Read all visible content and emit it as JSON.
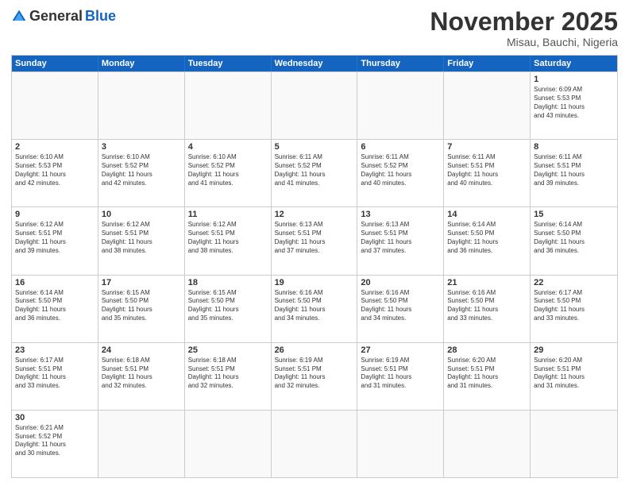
{
  "logo": {
    "general": "General",
    "blue": "Blue"
  },
  "title": "November 2025",
  "location": "Misau, Bauchi, Nigeria",
  "headers": [
    "Sunday",
    "Monday",
    "Tuesday",
    "Wednesday",
    "Thursday",
    "Friday",
    "Saturday"
  ],
  "rows": [
    [
      {
        "day": "",
        "text": ""
      },
      {
        "day": "",
        "text": ""
      },
      {
        "day": "",
        "text": ""
      },
      {
        "day": "",
        "text": ""
      },
      {
        "day": "",
        "text": ""
      },
      {
        "day": "",
        "text": ""
      },
      {
        "day": "1",
        "text": "Sunrise: 6:09 AM\nSunset: 5:53 PM\nDaylight: 11 hours\nand 43 minutes."
      }
    ],
    [
      {
        "day": "2",
        "text": "Sunrise: 6:10 AM\nSunset: 5:53 PM\nDaylight: 11 hours\nand 42 minutes."
      },
      {
        "day": "3",
        "text": "Sunrise: 6:10 AM\nSunset: 5:52 PM\nDaylight: 11 hours\nand 42 minutes."
      },
      {
        "day": "4",
        "text": "Sunrise: 6:10 AM\nSunset: 5:52 PM\nDaylight: 11 hours\nand 41 minutes."
      },
      {
        "day": "5",
        "text": "Sunrise: 6:11 AM\nSunset: 5:52 PM\nDaylight: 11 hours\nand 41 minutes."
      },
      {
        "day": "6",
        "text": "Sunrise: 6:11 AM\nSunset: 5:52 PM\nDaylight: 11 hours\nand 40 minutes."
      },
      {
        "day": "7",
        "text": "Sunrise: 6:11 AM\nSunset: 5:51 PM\nDaylight: 11 hours\nand 40 minutes."
      },
      {
        "day": "8",
        "text": "Sunrise: 6:11 AM\nSunset: 5:51 PM\nDaylight: 11 hours\nand 39 minutes."
      }
    ],
    [
      {
        "day": "9",
        "text": "Sunrise: 6:12 AM\nSunset: 5:51 PM\nDaylight: 11 hours\nand 39 minutes."
      },
      {
        "day": "10",
        "text": "Sunrise: 6:12 AM\nSunset: 5:51 PM\nDaylight: 11 hours\nand 38 minutes."
      },
      {
        "day": "11",
        "text": "Sunrise: 6:12 AM\nSunset: 5:51 PM\nDaylight: 11 hours\nand 38 minutes."
      },
      {
        "day": "12",
        "text": "Sunrise: 6:13 AM\nSunset: 5:51 PM\nDaylight: 11 hours\nand 37 minutes."
      },
      {
        "day": "13",
        "text": "Sunrise: 6:13 AM\nSunset: 5:51 PM\nDaylight: 11 hours\nand 37 minutes."
      },
      {
        "day": "14",
        "text": "Sunrise: 6:14 AM\nSunset: 5:50 PM\nDaylight: 11 hours\nand 36 minutes."
      },
      {
        "day": "15",
        "text": "Sunrise: 6:14 AM\nSunset: 5:50 PM\nDaylight: 11 hours\nand 36 minutes."
      }
    ],
    [
      {
        "day": "16",
        "text": "Sunrise: 6:14 AM\nSunset: 5:50 PM\nDaylight: 11 hours\nand 36 minutes."
      },
      {
        "day": "17",
        "text": "Sunrise: 6:15 AM\nSunset: 5:50 PM\nDaylight: 11 hours\nand 35 minutes."
      },
      {
        "day": "18",
        "text": "Sunrise: 6:15 AM\nSunset: 5:50 PM\nDaylight: 11 hours\nand 35 minutes."
      },
      {
        "day": "19",
        "text": "Sunrise: 6:16 AM\nSunset: 5:50 PM\nDaylight: 11 hours\nand 34 minutes."
      },
      {
        "day": "20",
        "text": "Sunrise: 6:16 AM\nSunset: 5:50 PM\nDaylight: 11 hours\nand 34 minutes."
      },
      {
        "day": "21",
        "text": "Sunrise: 6:16 AM\nSunset: 5:50 PM\nDaylight: 11 hours\nand 33 minutes."
      },
      {
        "day": "22",
        "text": "Sunrise: 6:17 AM\nSunset: 5:50 PM\nDaylight: 11 hours\nand 33 minutes."
      }
    ],
    [
      {
        "day": "23",
        "text": "Sunrise: 6:17 AM\nSunset: 5:51 PM\nDaylight: 11 hours\nand 33 minutes."
      },
      {
        "day": "24",
        "text": "Sunrise: 6:18 AM\nSunset: 5:51 PM\nDaylight: 11 hours\nand 32 minutes."
      },
      {
        "day": "25",
        "text": "Sunrise: 6:18 AM\nSunset: 5:51 PM\nDaylight: 11 hours\nand 32 minutes."
      },
      {
        "day": "26",
        "text": "Sunrise: 6:19 AM\nSunset: 5:51 PM\nDaylight: 11 hours\nand 32 minutes."
      },
      {
        "day": "27",
        "text": "Sunrise: 6:19 AM\nSunset: 5:51 PM\nDaylight: 11 hours\nand 31 minutes."
      },
      {
        "day": "28",
        "text": "Sunrise: 6:20 AM\nSunset: 5:51 PM\nDaylight: 11 hours\nand 31 minutes."
      },
      {
        "day": "29",
        "text": "Sunrise: 6:20 AM\nSunset: 5:51 PM\nDaylight: 11 hours\nand 31 minutes."
      }
    ],
    [
      {
        "day": "30",
        "text": "Sunrise: 6:21 AM\nSunset: 5:52 PM\nDaylight: 11 hours\nand 30 minutes."
      },
      {
        "day": "",
        "text": ""
      },
      {
        "day": "",
        "text": ""
      },
      {
        "day": "",
        "text": ""
      },
      {
        "day": "",
        "text": ""
      },
      {
        "day": "",
        "text": ""
      },
      {
        "day": "",
        "text": ""
      }
    ]
  ]
}
